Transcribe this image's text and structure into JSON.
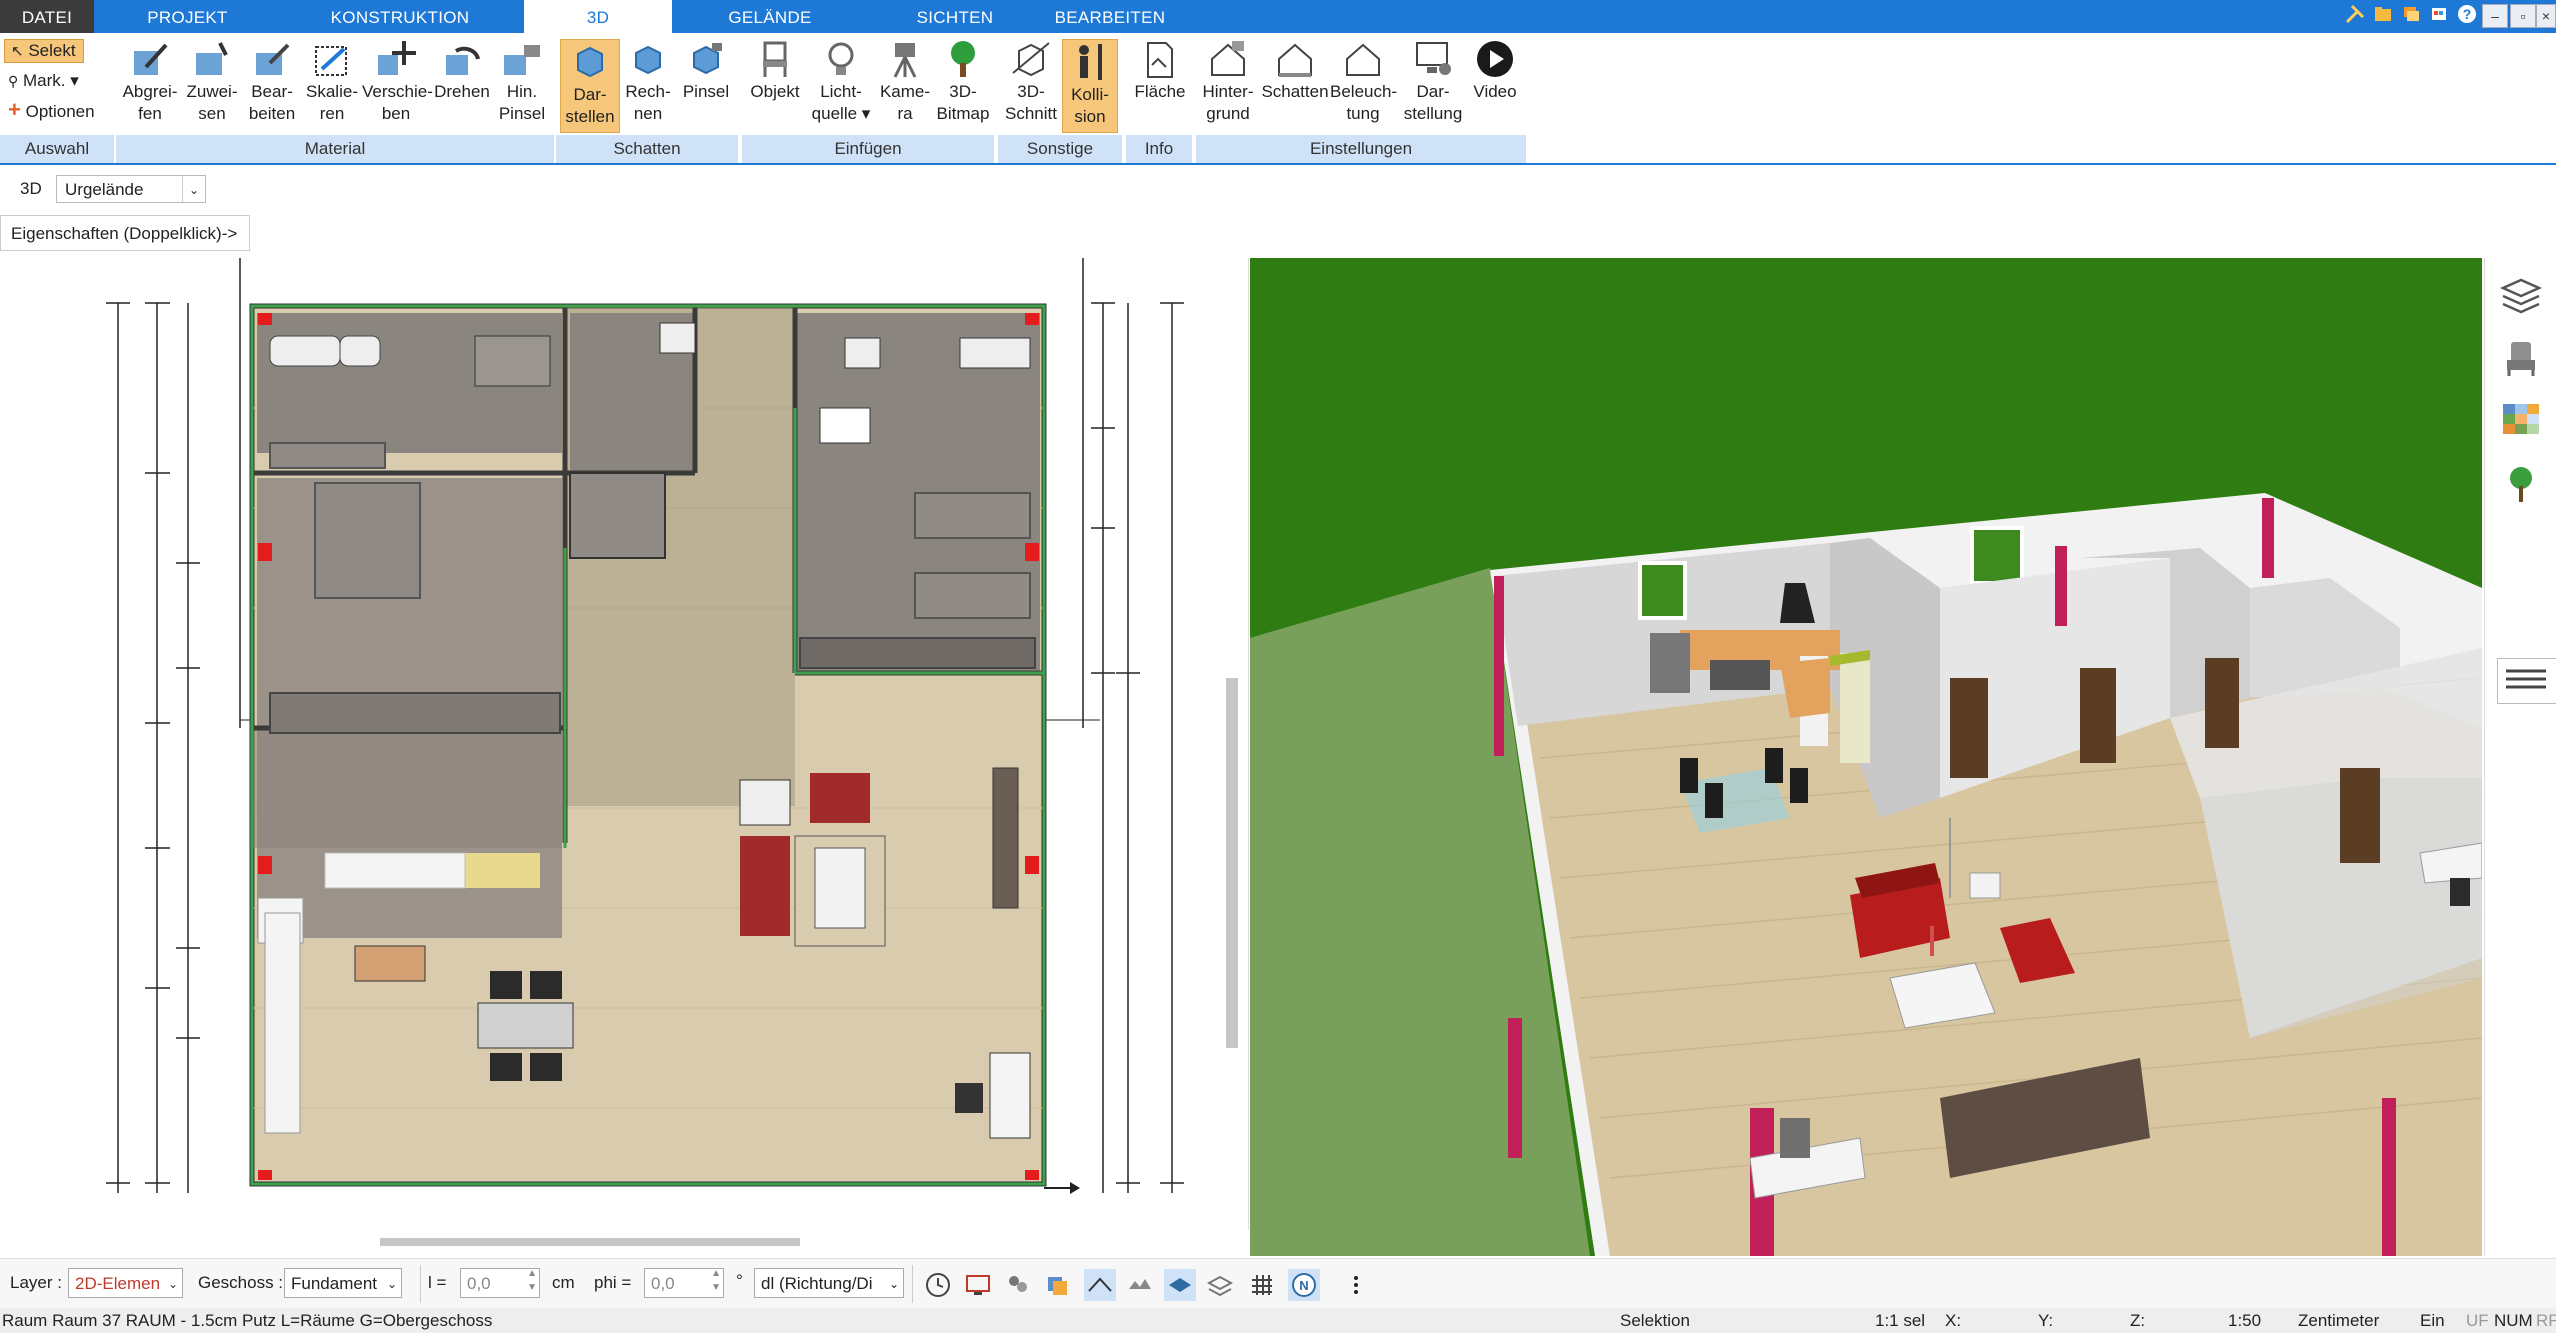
{
  "menu": {
    "tabs": [
      "DATEI",
      "PROJEKT",
      "KONSTRUKTION",
      "3D",
      "GELÄNDE",
      "SICHTEN",
      "BEARBEITEN"
    ],
    "active": "3D"
  },
  "ribbon": {
    "auswahl": {
      "selekt": "Selekt",
      "mark": "Mark.",
      "optionen": "Optionen",
      "group": "Auswahl"
    },
    "material": {
      "group": "Material",
      "buttons": [
        {
          "l1": "Abgrei-",
          "l2": "fen"
        },
        {
          "l1": "Zuwei-",
          "l2": "sen"
        },
        {
          "l1": "Bear-",
          "l2": "beiten"
        },
        {
          "l1": "Skalie-",
          "l2": "ren"
        },
        {
          "l1": "Verschie-",
          "l2": "ben"
        },
        {
          "l1": "Drehen",
          "l2": ""
        },
        {
          "l1": "Hin.",
          "l2": "Pinsel"
        }
      ]
    },
    "schatten": {
      "group": "Schatten",
      "buttons": [
        {
          "l1": "Dar-",
          "l2": "stellen"
        },
        {
          "l1": "Rech-",
          "l2": "nen"
        },
        {
          "l1": "Pinsel",
          "l2": ""
        }
      ]
    },
    "einfuegen": {
      "group": "Einfügen",
      "buttons": [
        {
          "l1": "Objekt",
          "l2": ""
        },
        {
          "l1": "Licht-",
          "l2": "quelle ▾"
        },
        {
          "l1": "Kame-",
          "l2": "ra"
        },
        {
          "l1": "3D-",
          "l2": "Bitmap"
        }
      ]
    },
    "sonstige": {
      "group": "Sonstige",
      "buttons": [
        {
          "l1": "3D-",
          "l2": "Schnitt"
        },
        {
          "l1": "Kolli-",
          "l2": "sion"
        }
      ]
    },
    "info": {
      "group": "Info",
      "buttons": [
        {
          "l1": "Fläche",
          "l2": ""
        }
      ]
    },
    "einstellungen": {
      "group": "Einstellungen",
      "buttons": [
        {
          "l1": "Hinter-",
          "l2": "grund"
        },
        {
          "l1": "Schatten",
          "l2": ""
        },
        {
          "l1": "Beleuch-",
          "l2": "tung"
        },
        {
          "l1": "Dar-",
          "l2": "stellung"
        },
        {
          "l1": "Video",
          "l2": ""
        }
      ]
    }
  },
  "toolbar2": {
    "mode": "3D",
    "terrain": "Urgelände"
  },
  "properties_hint": "Eigenschaften (Doppelklick)->",
  "layerbar": {
    "layer_label": "Layer :",
    "layer_value": "2D-Elemen",
    "geschoss_label": "Geschoss :",
    "geschoss_value": "Fundament",
    "l_label": "l =",
    "l_value": "0,0",
    "l_unit": "cm",
    "phi_label": "phi =",
    "phi_value": "0,0",
    "phi_unit": "°",
    "direction": "dl (Richtung/Di"
  },
  "status": {
    "left": "Raum Raum 37 RAUM - 1.5cm Putz L=Räume G=Obergeschoss",
    "mode": "Selektion",
    "sel": "1:1 sel",
    "x": "X:",
    "y": "Y:",
    "z": "Z:",
    "scale": "1:50",
    "unit": "Zentimeter",
    "ein": "Ein",
    "uf": "UF",
    "num": "NUM",
    "rf": "RF"
  },
  "colors": {
    "accent": "#1e78d6",
    "ribbon_group": "#cfe2f7",
    "selected": "#f6c77a",
    "grass": "#2f7d12",
    "floor": "#d8c9a8"
  }
}
